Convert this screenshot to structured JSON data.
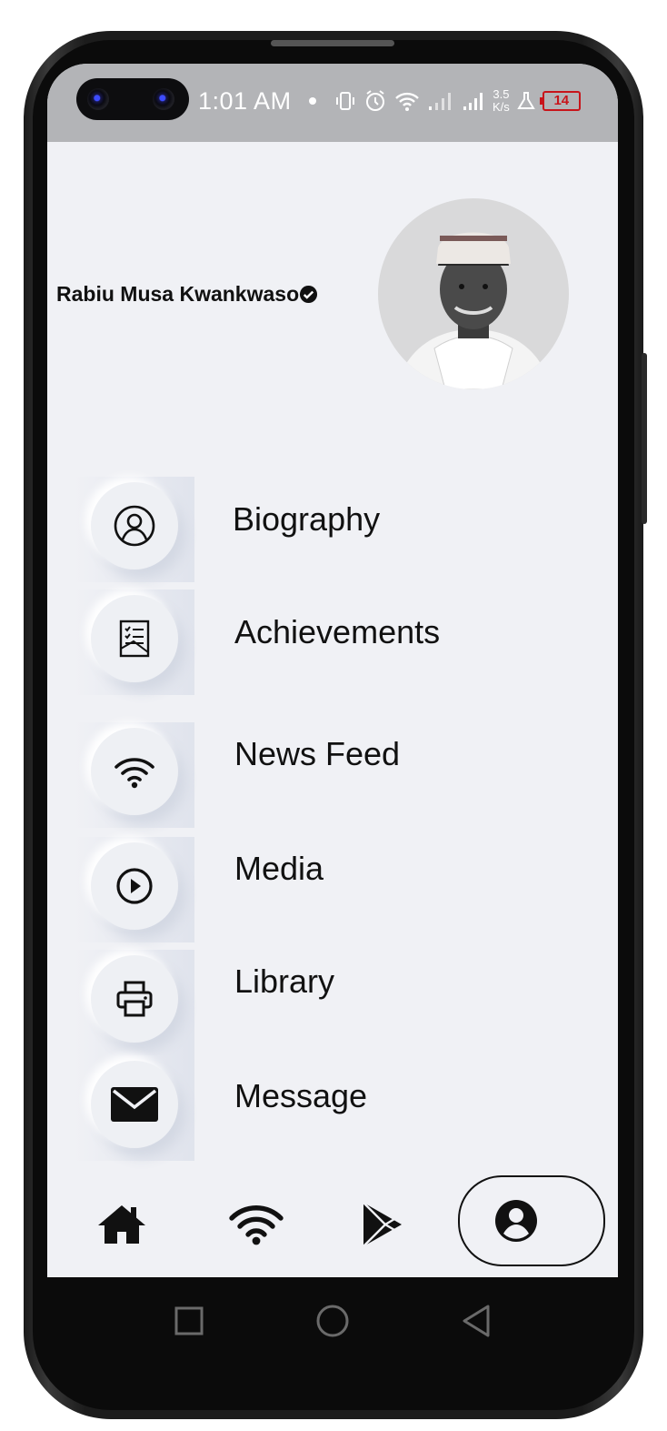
{
  "status_bar": {
    "time": "1:01 AM",
    "speed_value": "3.5",
    "speed_unit": "K/s",
    "battery": "14",
    "icons": [
      "vibrate-icon",
      "alarm-icon",
      "wifi-icon",
      "signal-icon",
      "signal-icon",
      "lab-icon",
      "battery-icon"
    ]
  },
  "profile": {
    "name": "Rabiu Musa Kwankwaso",
    "verified": true
  },
  "menu": {
    "items": [
      {
        "label": "Biography",
        "icon": "person-circle-icon"
      },
      {
        "label": "Achievements",
        "icon": "checklist-document-icon"
      },
      {
        "label": "News Feed",
        "icon": "wifi-icon"
      },
      {
        "label": "Media",
        "icon": "play-circle-icon"
      },
      {
        "label": "Library",
        "icon": "printer-icon"
      },
      {
        "label": "Message",
        "icon": "envelope-icon"
      }
    ]
  },
  "bottom_nav": {
    "items": [
      "home-icon",
      "wifi-icon",
      "play-store-icon",
      "account-circle-icon"
    ],
    "active": "account-circle-icon"
  },
  "system_nav": {
    "items": [
      "recents-square-icon",
      "home-circle-icon",
      "back-triangle-icon"
    ]
  },
  "colors": {
    "screen_bg": "#f0f1f5",
    "status_bar_bg": "#b3b4b7",
    "battery_low": "#c8151b",
    "text": "#111111"
  }
}
